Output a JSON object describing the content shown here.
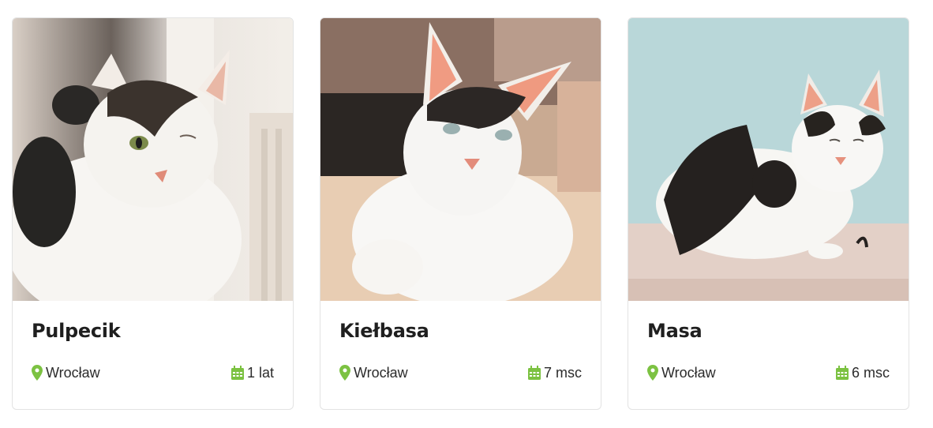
{
  "cats": [
    {
      "name": "Pulpecik",
      "location": "Wrocław",
      "age": "1 lat",
      "photo_alt": "Pulpecik"
    },
    {
      "name": "Kiełbasa",
      "location": "Wrocław",
      "age": "7 msc",
      "photo_alt": "Kiełbasa"
    },
    {
      "name": "Masa",
      "location": "Wrocław",
      "age": "6 msc",
      "photo_alt": "Masa"
    }
  ],
  "icons": {
    "location": "map-marker-icon",
    "age": "calendar-icon"
  },
  "colors": {
    "accent": "#7cc242",
    "text": "#1f1f1f",
    "border": "#e3e3e3"
  }
}
